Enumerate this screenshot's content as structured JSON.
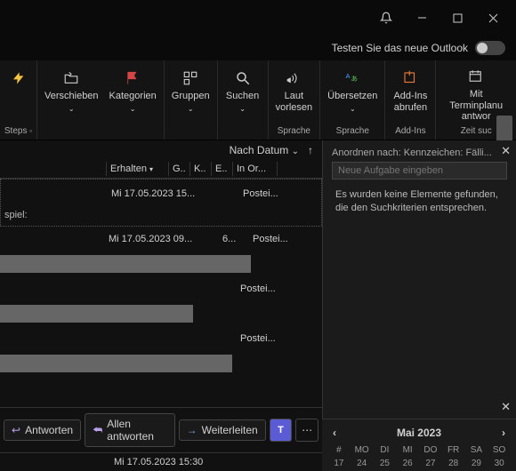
{
  "titlebar": {
    "try_new_label": "Testen Sie das neue Outlook"
  },
  "ribbon": {
    "quicksteps_label": "Steps",
    "buttons": {
      "move": "Verschieben",
      "categories": "Kategorien",
      "groups": "Gruppen",
      "search": "Suchen",
      "read_aloud": "Laut\nvorlesen",
      "translate": "Übersetzen",
      "addins": "Add-Ins\nabrufen",
      "scheduling": "Mit Terminplanu\nantwor"
    },
    "group_labels": {
      "language1": "Sprache",
      "language2": "Sprache",
      "addins": "Add-Ins",
      "find_time": "Zeit suc"
    }
  },
  "mail": {
    "sort_label": "Nach Datum",
    "columns": {
      "received": "Erhalten",
      "g": "G..",
      "k": "K..",
      "e": "E..",
      "inorder": "In Or..."
    },
    "rows": [
      {
        "date": "Mi 17.05.2023 15...",
        "folder": "Postei..."
      },
      {
        "date": "Mi 17.05.2023 09...",
        "size": "6...",
        "folder": "Postei..."
      },
      {
        "date": "",
        "folder": "Postei..."
      },
      {
        "date": "",
        "folder": "Postei..."
      }
    ],
    "group_label": "spiel:",
    "actions": {
      "reply": "Antworten",
      "reply_all": "Allen antworten",
      "forward": "Weiterleiten"
    },
    "selected_timestamp": "Mi 17.05.2023 15:30"
  },
  "tasks": {
    "arrange_label": "Anordnen nach: Kennzeichen: Fälli...",
    "input_placeholder": "Neue Aufgabe eingeben",
    "empty_message": "Es wurden keine Elemente gefunden, die den Suchkriterien entsprechen."
  },
  "calendar": {
    "title": "Mai 2023",
    "weekdays": [
      "#",
      "MO",
      "DI",
      "MI",
      "DO",
      "FR",
      "SA",
      "SO"
    ],
    "week_row": [
      "17",
      "24",
      "25",
      "26",
      "27",
      "28",
      "29",
      "30"
    ]
  }
}
